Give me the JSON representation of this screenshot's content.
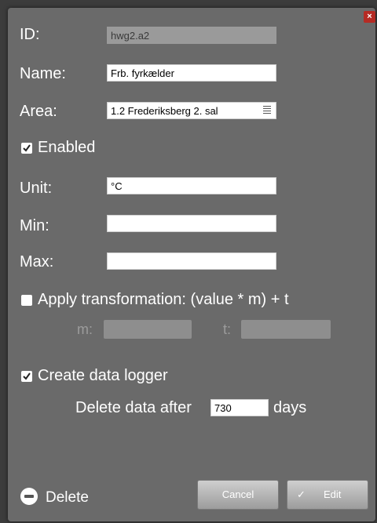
{
  "dialog": {
    "close_label": "×",
    "id_label": "ID:",
    "id_value": "hwg2.a2",
    "name_label": "Name:",
    "name_value": "Frb. fyrkælder",
    "area_label": "Area:",
    "area_value": "1.2 Frederiksberg 2. sal",
    "enabled_label": "Enabled",
    "enabled_checked": true,
    "unit_label": "Unit:",
    "unit_value": "°C",
    "min_label": "Min:",
    "min_value": "",
    "max_label": "Max:",
    "max_value": "",
    "transform_label": "Apply transformation: (value * m) + t",
    "transform_checked": false,
    "m_label": "m:",
    "t_label": "t:",
    "logger_label": "Create data logger",
    "logger_checked": true,
    "delete_after_label": "Delete data after",
    "delete_after_value": "730",
    "days_label": "days",
    "delete_label": "Delete",
    "cancel_label": "Cancel",
    "edit_label": "Edit",
    "edit_check": "✓"
  },
  "colors": {
    "dialog_bg": "#6a6a6a",
    "close_red": "#b52b24",
    "button_gradient_top": "#cfcfcf",
    "button_gradient_bottom": "#9c9c9c"
  }
}
